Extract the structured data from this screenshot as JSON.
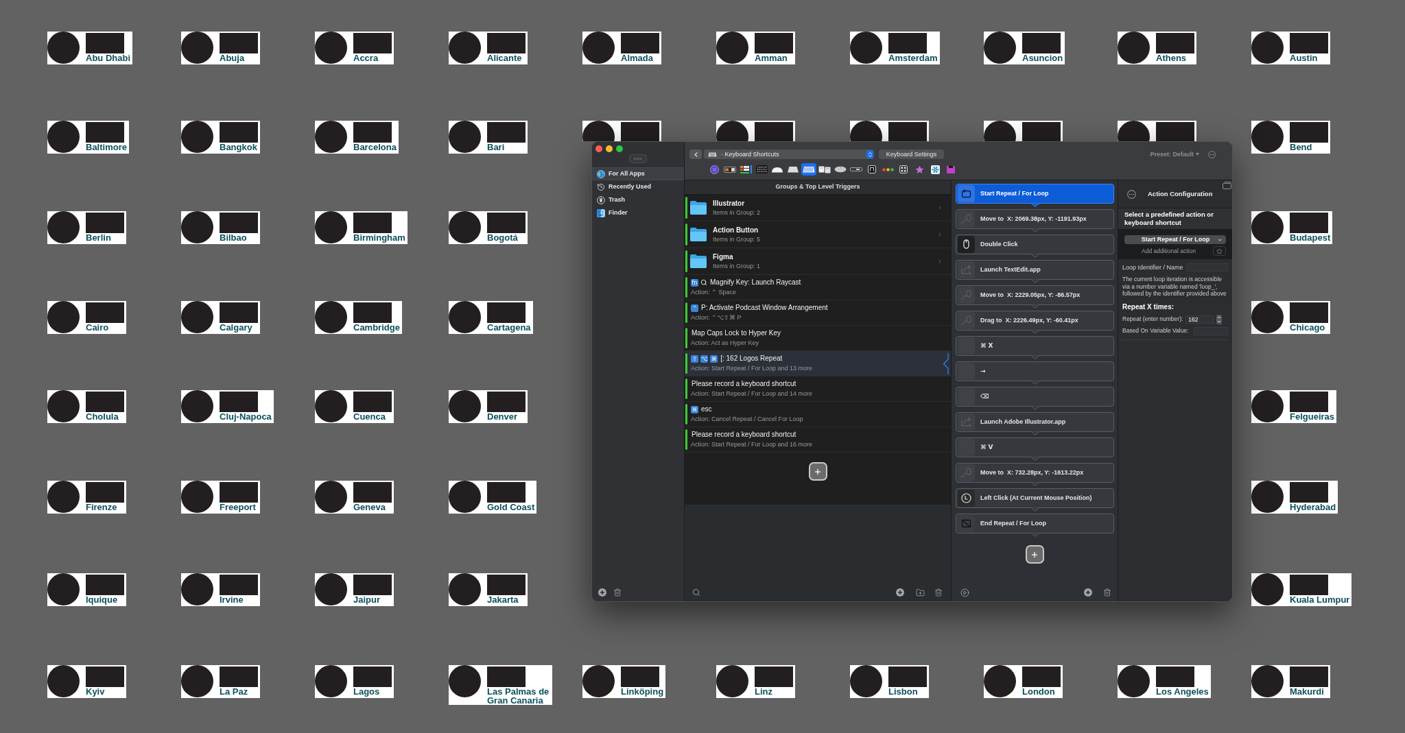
{
  "wallpaper": {
    "rows": [
      {
        "cards": [
          {
            "kind": "label",
            "city": "Abu Dhabi"
          },
          {
            "kind": "label",
            "city": "Abuja"
          },
          {
            "kind": "label",
            "city": "Accra"
          },
          {
            "kind": "label",
            "city": "Alicante"
          },
          {
            "kind": "label",
            "city": "Almada"
          },
          {
            "kind": "label",
            "city": "Amman"
          },
          {
            "kind": "label",
            "city": "Amsterdam"
          },
          {
            "kind": "label",
            "city": "Asuncion"
          },
          {
            "kind": "label",
            "city": "Athens"
          },
          {
            "kind": "label",
            "city": "Austin"
          }
        ]
      },
      {
        "cards": [
          {
            "kind": "label",
            "city": "Baltimore"
          },
          {
            "kind": "label",
            "city": "Bangkok"
          },
          {
            "kind": "label",
            "city": "Barcelona"
          },
          {
            "kind": "label",
            "city": "Bari"
          },
          {
            "kind": "edge"
          },
          {
            "kind": "edge"
          },
          {
            "kind": "edge"
          },
          {
            "kind": "edge"
          },
          {
            "kind": "edge"
          },
          {
            "kind": "label",
            "city": "Bend"
          }
        ]
      },
      {
        "cards": [
          {
            "kind": "label",
            "city": "Berlin"
          },
          {
            "kind": "label",
            "city": "Bilbao"
          },
          {
            "kind": "label",
            "city": "Birmingham"
          },
          {
            "kind": "label",
            "city": "Bogotá"
          },
          {
            "kind": "label",
            "city": "Budapest"
          }
        ]
      },
      {
        "cards": [
          {
            "kind": "label",
            "city": "Cairo"
          },
          {
            "kind": "label",
            "city": "Calgary"
          },
          {
            "kind": "label",
            "city": "Cambridge"
          },
          {
            "kind": "label",
            "city": "Cartagena"
          },
          {
            "kind": "label",
            "city": "Chicago"
          }
        ]
      },
      {
        "cards": [
          {
            "kind": "label",
            "city": "Cholula"
          },
          {
            "kind": "label",
            "city": "Cluj-Napoca"
          },
          {
            "kind": "label",
            "city": "Cuenca"
          },
          {
            "kind": "label",
            "city": "Denver"
          },
          {
            "kind": "label",
            "city": "Felgueiras"
          }
        ]
      },
      {
        "cards": [
          {
            "kind": "label",
            "city": "Firenze"
          },
          {
            "kind": "label",
            "city": "Freeport"
          },
          {
            "kind": "label",
            "city": "Geneva"
          },
          {
            "kind": "label",
            "city": "Gold Coast"
          },
          {
            "kind": "label",
            "city": "Hyderabad"
          }
        ]
      },
      {
        "cards": [
          {
            "kind": "label",
            "city": "Iquique"
          },
          {
            "kind": "label",
            "city": "Irvine"
          },
          {
            "kind": "label",
            "city": "Jaipur"
          },
          {
            "kind": "label",
            "city": "Jakarta"
          },
          {
            "kind": "label",
            "city": "Kuala Lumpur"
          }
        ]
      },
      {
        "cards": [
          {
            "kind": "label",
            "city": "Kyiv"
          },
          {
            "kind": "label",
            "city": "La Paz"
          },
          {
            "kind": "label",
            "city": "Lagos"
          },
          {
            "kind": "label",
            "city": "Las Palmas de Gran Canaria"
          },
          {
            "kind": "label",
            "city": "Linköping"
          },
          {
            "kind": "label",
            "city": "Linz"
          },
          {
            "kind": "label",
            "city": "Lisbon"
          },
          {
            "kind": "label",
            "city": "London"
          },
          {
            "kind": "label",
            "city": "Los Angeles"
          },
          {
            "kind": "label",
            "city": "Makurdi"
          }
        ]
      }
    ]
  },
  "window": {
    "sidebar": {
      "collapse_button": "<<<",
      "items": [
        {
          "label": "For All Apps",
          "selected": true
        },
        {
          "label": "Recently Used",
          "selected": false
        },
        {
          "label": "Trash",
          "selected": false
        },
        {
          "label": "Finder",
          "selected": false
        }
      ]
    },
    "toolbar": {
      "category": "· Keyboard Shortcuts",
      "settings_button": "Keyboard Settings",
      "preset": "Preset: Default",
      "trigger_types": [
        {
          "selected": false
        },
        {
          "selected": false
        },
        {
          "selected": false
        },
        {
          "selected": false
        },
        {
          "selected": false
        },
        {
          "selected": false
        },
        {
          "selected": true
        },
        {
          "selected": false
        },
        {
          "selected": false
        },
        {
          "selected": false
        },
        {
          "selected": false
        },
        {
          "selected": false
        },
        {
          "selected": false
        },
        {
          "selected": false
        },
        {
          "selected": false
        },
        {
          "selected": false
        }
      ]
    },
    "groups": {
      "title": "Groups & Top Level Triggers",
      "rows": [
        {
          "kind": "group",
          "title": "Illustrator",
          "subtitle": "Items in Group: 2",
          "enabled": true,
          "selected": false
        },
        {
          "kind": "group",
          "title": "Action Button",
          "subtitle": "Items in Group: 5",
          "enabled": true,
          "selected": false
        },
        {
          "kind": "group",
          "title": "Figma",
          "subtitle": "Items in Group: 1",
          "enabled": true,
          "selected": false
        },
        {
          "kind": "trigger",
          "keys": [
            "fn"
          ],
          "title_icon": true,
          "title": "Magnify Key: Launch Raycast",
          "subtitle": "Action: ⌃ Space",
          "enabled": true,
          "selected": false
        },
        {
          "kind": "trigger",
          "keys": [
            "⌃"
          ],
          "title": "P: Activate Podcast Window Arrangement",
          "subtitle": "Action: ⌃⌥⇧⌘ P",
          "enabled": true,
          "selected": false
        },
        {
          "kind": "trigger",
          "title": "Map Caps Lock to Hyper Key",
          "subtitle": "Action: Act as Hyper Key",
          "enabled": true,
          "selected": false
        },
        {
          "kind": "trigger",
          "keys": [
            "⇪",
            "⌥",
            "⌘"
          ],
          "title": "[: 162 Logos Repeat",
          "subtitle": "Action: Start Repeat / For Loop and 13 more",
          "enabled": true,
          "selected": true
        },
        {
          "kind": "trigger",
          "title": "Please record a keyboard shortcut",
          "subtitle": "Action: Start Repeat / For Loop and 14 more",
          "enabled": true,
          "selected": false
        },
        {
          "kind": "trigger",
          "keys": [
            "⌘"
          ],
          "title": "esc",
          "subtitle": "Action: Cancel Repeat / Cancel For Loop",
          "enabled": true,
          "selected": false
        },
        {
          "kind": "trigger",
          "title": "Please record a keyboard shortcut",
          "subtitle": "Action: Start Repeat / For Loop and 16 more",
          "enabled": true,
          "selected": false
        }
      ]
    },
    "actions": {
      "items": [
        {
          "kind": "loop_start",
          "label": "Start Repeat / For Loop",
          "selected": true
        },
        {
          "kind": "mouse_move",
          "label": "Move to  X: 2069.38px, Y: -1191.93px",
          "selected": false
        },
        {
          "kind": "double_click",
          "label": "Double Click",
          "selected": false
        },
        {
          "kind": "launch_app",
          "label": "Launch TextEdit.app",
          "selected": false
        },
        {
          "kind": "mouse_move",
          "label": "Move to  X: 2229.05px, Y: -86.57px",
          "selected": false
        },
        {
          "kind": "mouse_move",
          "label": "Drag to  X: 2226.49px, Y: -60.41px",
          "selected": false
        },
        {
          "kind": "shortcut",
          "label": "⌘ X",
          "selected": false
        },
        {
          "kind": "shortcut",
          "label": "→",
          "selected": false
        },
        {
          "kind": "shortcut",
          "label": "⌫",
          "selected": false
        },
        {
          "kind": "launch_app",
          "label": "Launch Adobe Illustrator.app",
          "selected": false
        },
        {
          "kind": "shortcut",
          "label": "⌘ V",
          "selected": false
        },
        {
          "kind": "mouse_move",
          "label": "Move to  X: 732.28px, Y: -1613.22px",
          "selected": false
        },
        {
          "kind": "left_click",
          "label": "Left Click (At Current Mouse Position)",
          "selected": false
        },
        {
          "kind": "loop_end",
          "label": "End Repeat / For Loop",
          "selected": false
        }
      ]
    },
    "config": {
      "title": "Action Configuration",
      "prompt": "Select a predefined action or keyboard shortcut",
      "action_select": "Start Repeat / For Loop",
      "add_action": "Add additional action",
      "loop_name_label": "Loop Identifier / Name",
      "note": "The current loop iteration is accessible via a number variable named 'loop_', followed by the identifier provided above",
      "section_title": "Repeat X times:",
      "repeat_label": "Repeat (enter number):",
      "repeat_value": "162",
      "variable_label": "Based On Variable Value:"
    }
  }
}
